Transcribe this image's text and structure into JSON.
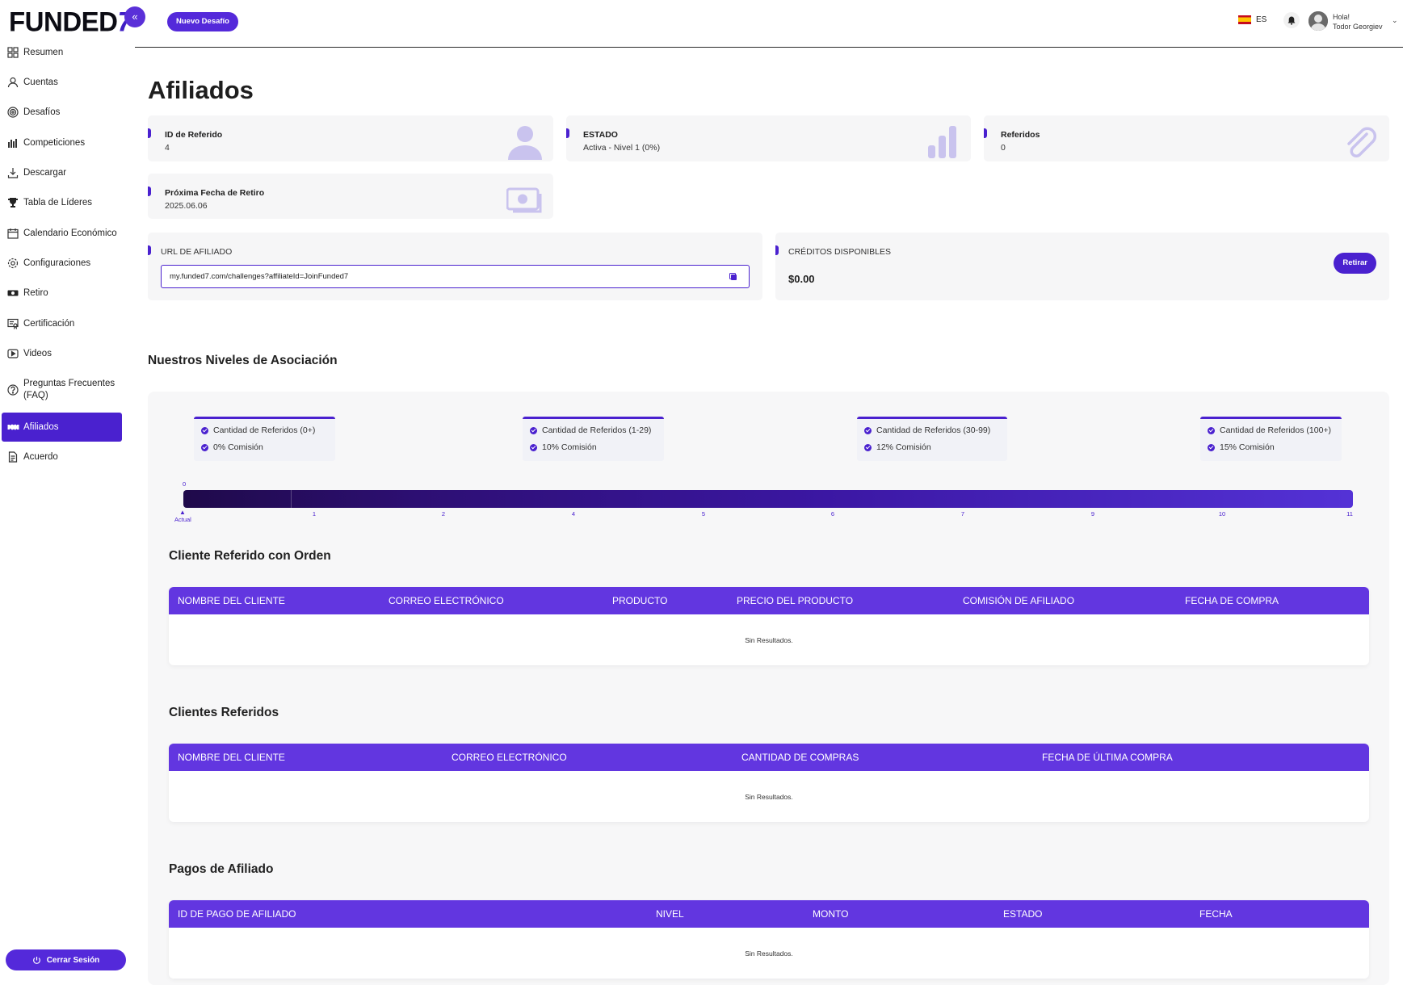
{
  "brand": {
    "logo_text": "FUNDED",
    "logo_seven": "7"
  },
  "header": {
    "new_challenge": "Nuevo Desafío",
    "language": "ES",
    "greeting": "Hola!",
    "user_name": "Todor Georgiev"
  },
  "sidebar": {
    "items": [
      {
        "label": "Resumen",
        "icon": "grid-icon"
      },
      {
        "label": "Cuentas",
        "icon": "user-icon"
      },
      {
        "label": "Desafíos",
        "icon": "target-icon"
      },
      {
        "label": "Competiciones",
        "icon": "bars-icon"
      },
      {
        "label": "Descargar",
        "icon": "download-icon"
      },
      {
        "label": "Tabla de Líderes",
        "icon": "trophy-icon"
      },
      {
        "label": "Calendario Económico",
        "icon": "calendar-icon"
      },
      {
        "label": "Configuraciones",
        "icon": "gear-icon"
      },
      {
        "label": "Retiro",
        "icon": "cash-icon"
      },
      {
        "label": "Certificación",
        "icon": "certificate-icon"
      },
      {
        "label": "Videos",
        "icon": "play-icon"
      },
      {
        "label": "Preguntas Frecuentes (FAQ)",
        "icon": "question-icon"
      },
      {
        "label": "Afiliados",
        "icon": "handshake-icon",
        "active": true
      },
      {
        "label": "Acuerdo",
        "icon": "document-icon"
      }
    ],
    "logout": "Cerrar Sesión"
  },
  "page": {
    "title": "Afiliados"
  },
  "stats": {
    "referral_id": {
      "label": "ID de Referido",
      "value": "4"
    },
    "status": {
      "label": "ESTADO",
      "value": "Activa - Nivel 1 (0%)"
    },
    "referrals": {
      "label": "Referidos",
      "value": "0"
    },
    "next_withdrawal": {
      "label": "Próxima Fecha de Retiro",
      "value": "2025.06.06"
    }
  },
  "affiliate_url": {
    "label": "URL DE AFILIADO",
    "value": "my.funded7.com/challenges?affiliateId=JoinFunded7"
  },
  "credits": {
    "label": "CRÉDITOS DISPONIBLES",
    "value": "$0.00",
    "withdraw": "Retirar"
  },
  "levels": {
    "title": "Nuestros Niveles de Asociación",
    "tiers": [
      {
        "referrals": "Cantidad de Referidos (0+)",
        "commission": "0% Comisión"
      },
      {
        "referrals": "Cantidad de Referidos (1-29)",
        "commission": "10% Comisión"
      },
      {
        "referrals": "Cantidad de Referidos (30-99)",
        "commission": "12% Comisión"
      },
      {
        "referrals": "Cantidad de Referidos (100+)",
        "commission": "15% Comisión"
      }
    ],
    "progress_value": "0",
    "current_label": "Actual",
    "ticks": [
      "0",
      "1",
      "2",
      "4",
      "5",
      "6",
      "7",
      "9",
      "10",
      "11"
    ]
  },
  "tables": [
    {
      "title": "Cliente Referido con Orden",
      "columns": [
        "NOMBRE DEL CLIENTE",
        "CORREO ELECTRÓNICO",
        "PRODUCTO",
        "PRECIO DEL PRODUCTO",
        "COMISIÓN DE AFILIADO",
        "FECHA DE COMPRA"
      ],
      "empty": "Sin Resultados."
    },
    {
      "title": "Clientes Referidos",
      "columns": [
        "NOMBRE DEL CLIENTE",
        "CORREO ELECTRÓNICO",
        "CANTIDAD DE COMPRAS",
        "FECHA DE ÚLTIMA COMPRA"
      ],
      "empty": "Sin Resultados."
    },
    {
      "title": "Pagos de Afiliado",
      "columns": [
        "ID DE PAGO DE AFILIADO",
        "NIVEL",
        "MONTO",
        "ESTADO",
        "FECHA"
      ],
      "empty": "Sin Resultados."
    }
  ]
}
